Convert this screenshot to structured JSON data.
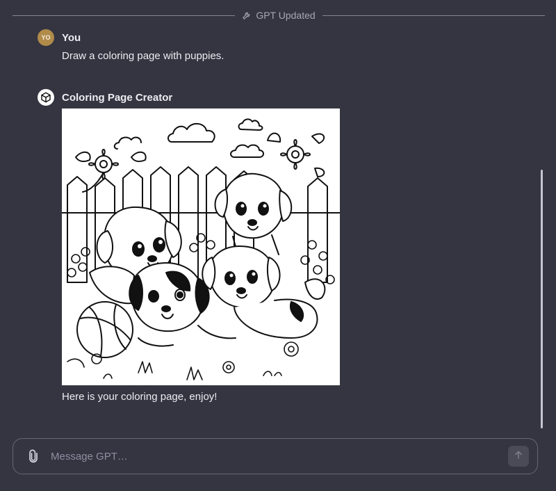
{
  "divider": {
    "label": "GPT Updated",
    "icon": "wrench-icon"
  },
  "messages": {
    "user": {
      "avatar_initials": "YO",
      "author": "You",
      "text": "Draw a coloring page with puppies."
    },
    "assistant": {
      "avatar_icon": "cube-icon",
      "author": "Coloring Page Creator",
      "image_subject": "puppies-coloring-page",
      "caption": "Here is your coloring page, enjoy!"
    }
  },
  "composer": {
    "placeholder": "Message GPT…",
    "attach_icon": "paperclip-icon",
    "send_icon": "arrow-up-icon"
  },
  "colors": {
    "background": "#343541",
    "text": "#ececf1",
    "user_avatar": "#b08b4a"
  }
}
